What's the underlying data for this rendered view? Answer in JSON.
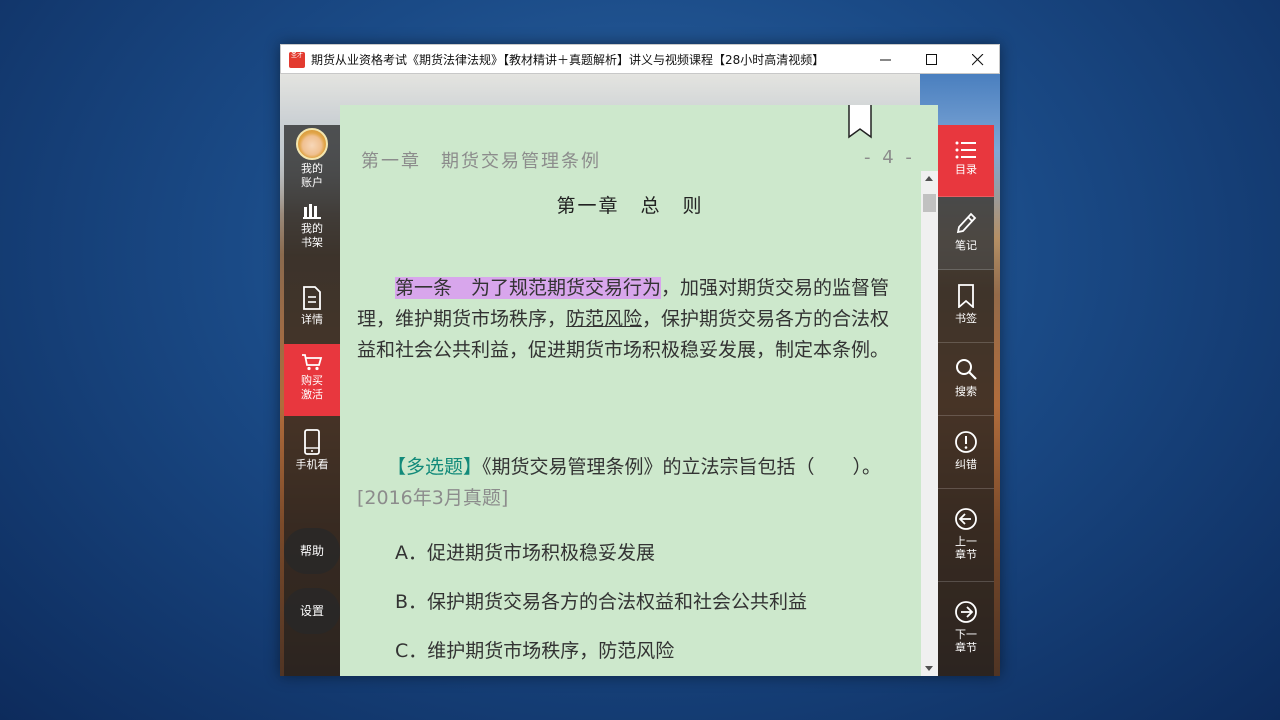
{
  "window": {
    "title": "期货从业资格考试《期货法律法规》【教材精讲＋真题解析】讲义与视频课程【28小时高清视频】",
    "app_icon_text": "圣才"
  },
  "left_sidebar": {
    "items": [
      {
        "label_line1": "我的",
        "label_line2": "账户",
        "icon": "avatar"
      },
      {
        "label_line1": "我的",
        "label_line2": "书架",
        "icon": "bookshelf-icon"
      },
      {
        "label_line1": "详情",
        "label_line2": "",
        "icon": "document-icon"
      },
      {
        "label_line1": "购买",
        "label_line2": "激活",
        "icon": "cart-icon"
      },
      {
        "label_line1": "手机看",
        "label_line2": "",
        "icon": "phone-icon"
      }
    ],
    "help_label": "帮助",
    "settings_label": "设置"
  },
  "right_sidebar": {
    "items": [
      {
        "label_line1": "目录",
        "label_line2": "",
        "icon": "list-icon"
      },
      {
        "label_line1": "笔记",
        "label_line2": "",
        "icon": "pencil-icon"
      },
      {
        "label_line1": "书签",
        "label_line2": "",
        "icon": "bookmark-icon"
      },
      {
        "label_line1": "搜索",
        "label_line2": "",
        "icon": "search-icon"
      },
      {
        "label_line1": "纠错",
        "label_line2": "",
        "icon": "alert-icon"
      },
      {
        "label_line1": "上一",
        "label_line2": "章节",
        "icon": "arrow-left-icon"
      },
      {
        "label_line1": "下一",
        "label_line2": "章节",
        "icon": "arrow-right-icon"
      }
    ]
  },
  "page": {
    "header_title": "第一章　期货交易管理条例",
    "page_number": "- 4 -",
    "chapter_heading": "第一章　总　则",
    "article": {
      "highlighted": "第一条　为了规范期货交易行为",
      "part1": "，加强对期货交易的监督管理，维护期货市场秩序，",
      "underlined": "防范风险",
      "part2": "，保护期货交易各方的合法权益和社会公共利益，促进期货市场积极稳妥发展，制定本条例。"
    },
    "question": {
      "tag": "【多选题】",
      "text": "《期货交易管理条例》的立法宗旨包括（　　）。",
      "source": "[2016年3月真题]"
    },
    "options": [
      "A．促进期货市场积极稳妥发展",
      "B．保护期货交易各方的合法权益和社会公共利益",
      "C．维护期货市场秩序，防范风险"
    ]
  }
}
